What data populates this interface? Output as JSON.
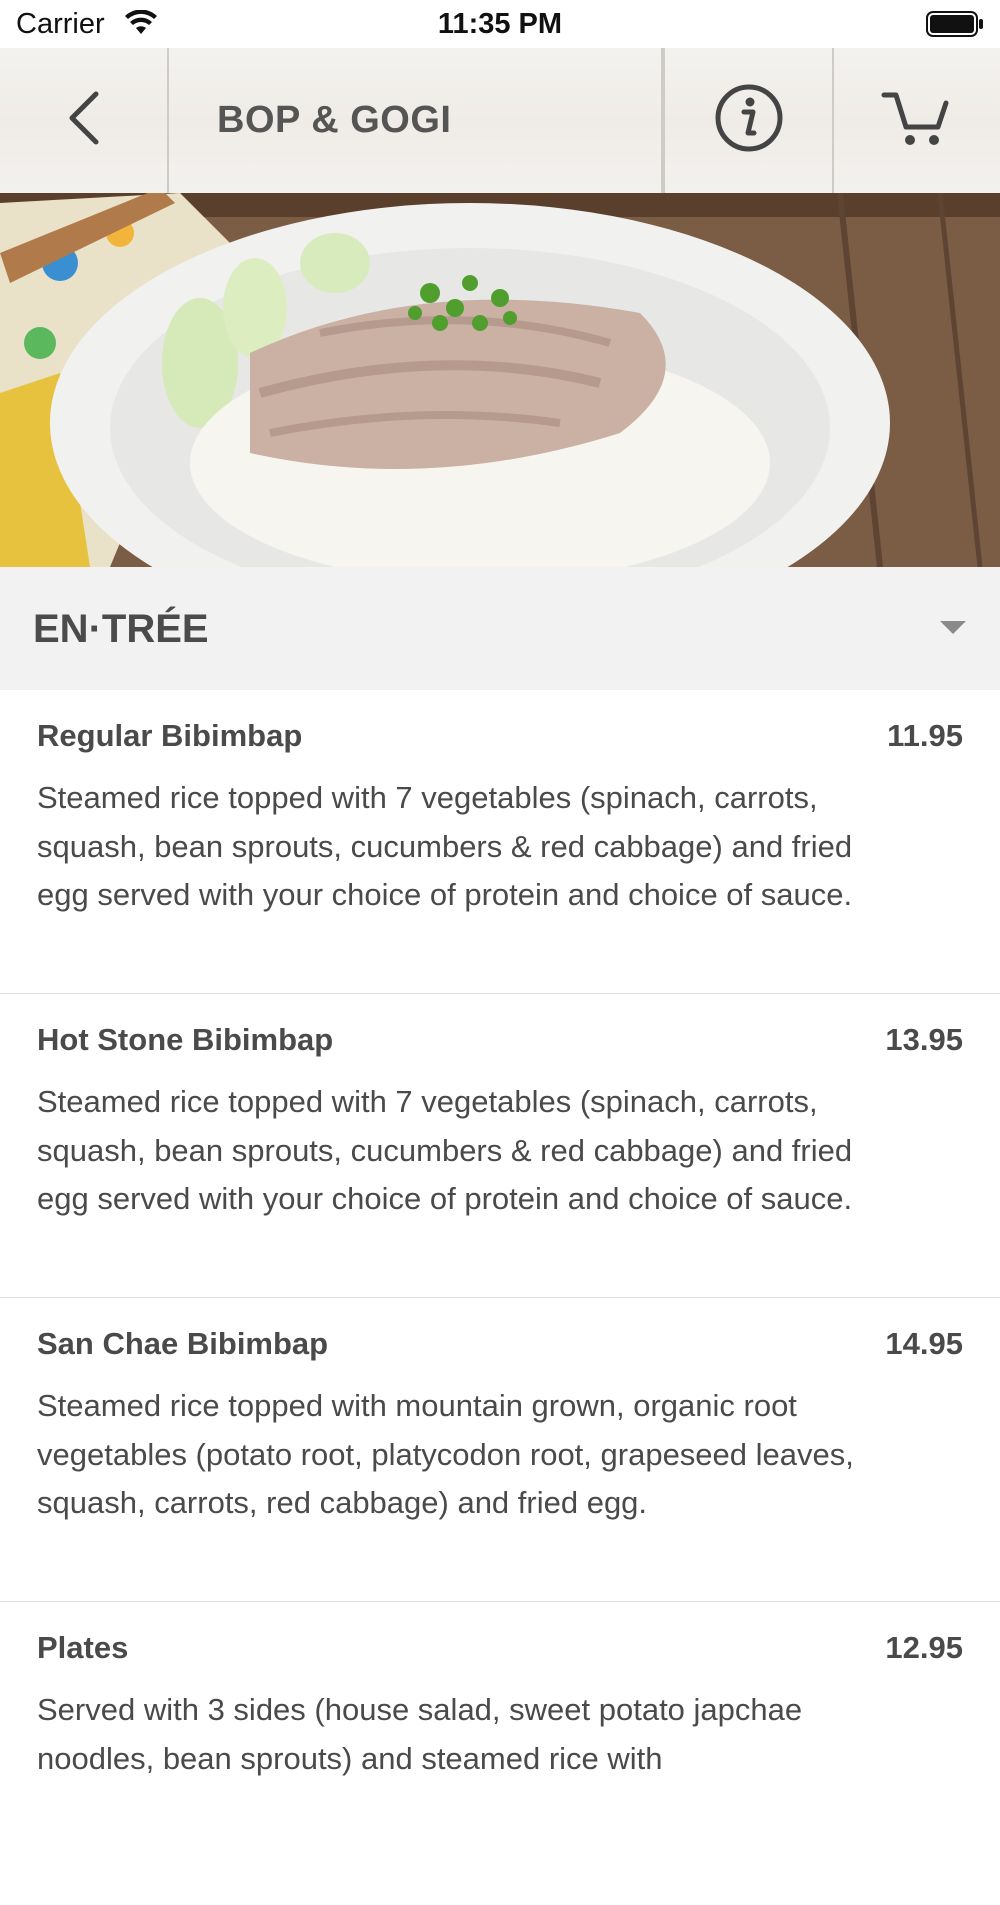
{
  "status_bar": {
    "carrier": "Carrier",
    "time": "11:35 PM"
  },
  "header": {
    "title": "BOP & GOGI",
    "icons": [
      "back-chevron-icon",
      "info-icon",
      "cart-icon"
    ]
  },
  "section": {
    "label": "EN·TRÉE"
  },
  "menu": {
    "items": [
      {
        "name": "Regular Bibimbap",
        "price": "11.95",
        "description": "Steamed rice topped with 7 vegetables (spinach, carrots, squash, bean sprouts, cucumbers & red cabbage) and fried egg served with your choice of protein and choice of sauce."
      },
      {
        "name": "Hot Stone Bibimbap",
        "price": "13.95",
        "description": "Steamed rice topped with 7 vegetables (spinach, carrots, squash, bean sprouts, cucumbers & red cabbage) and fried egg served with your choice of protein and choice of sauce."
      },
      {
        "name": "San Chae Bibimbap",
        "price": "14.95",
        "description": "Steamed rice topped with mountain grown, organic root vegetables (potato root, platycodon root, grapeseed leaves, squash, carrots, red cabbage) and fried egg."
      },
      {
        "name": "Plates",
        "price": "12.95",
        "description": "Served with 3 sides (house salad, sweet potato japchae noodles, bean sprouts) and steamed rice with"
      }
    ]
  },
  "colors": {
    "text": "#4a4a4a",
    "section_bg": "#f2f2f2",
    "divider": "#dcdcdc"
  }
}
